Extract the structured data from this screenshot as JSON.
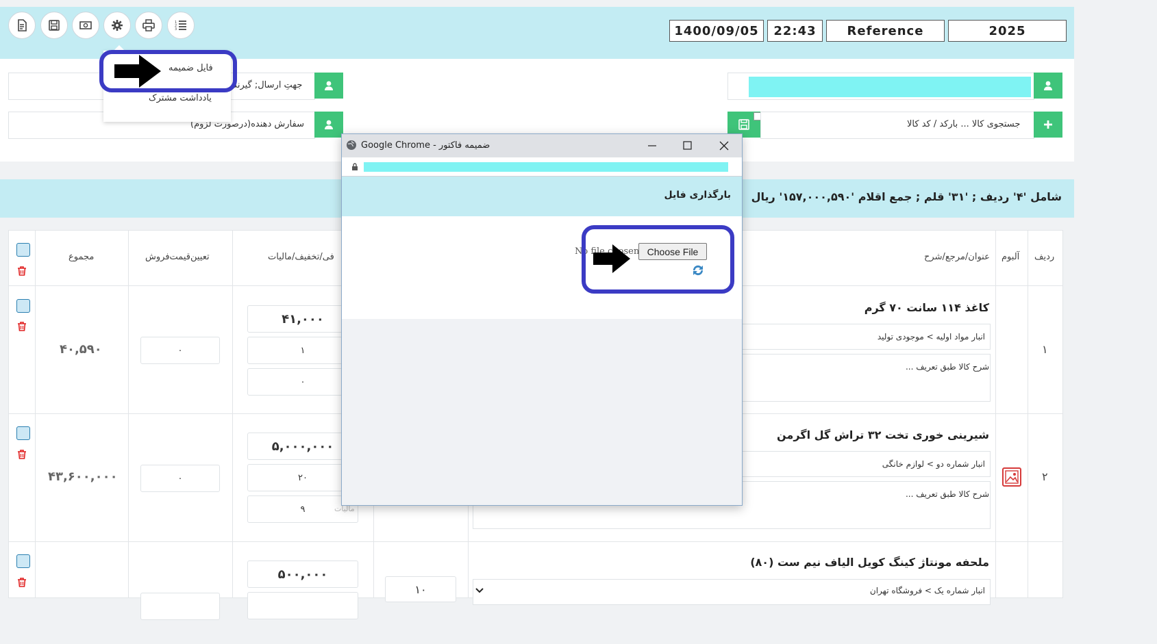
{
  "toolbar": {
    "buttons": [
      "document-icon",
      "save-icon",
      "money-icon",
      "gear-icon",
      "print-icon",
      "list-icon"
    ]
  },
  "header": {
    "date": "1400/09/05",
    "time": "22:43",
    "reference": "Reference",
    "number": "2025"
  },
  "dropdown_menu": {
    "items": [
      "فایل ضمیمه",
      "یادداشت مشترک"
    ]
  },
  "form": {
    "recipient_label": "جهتِ ارسال; گیرند",
    "orderer_label": "سفارش دهنده(درصورت لزوم)",
    "product_search_label": "جستجوی کالا ... بارکد / کد کالا"
  },
  "summary_text": "شامل '۴' ردیف ; '۳۱' قلم ; جمع اقلام '۱۵۷,۰۰۰,۵۹۰' ریال",
  "table": {
    "headers": {
      "row": "ردیف",
      "album": "آلبوم",
      "title": "عنوان/مرجع/شرح",
      "price": "فی/تخفیف/مالیات",
      "sale_price": "تعیین‌قیمت‌فروش",
      "total": "مجموع"
    },
    "rows": [
      {
        "num": "۱",
        "title": "کاغذ ۱۱۴ سانت ۷۰ گرم",
        "warehouse": "انبار مواد اولیه > موجودی تولید",
        "desc": "شرح کالا طبق تعریف ...",
        "price": "۴۱,۰۰۰",
        "discount": "۱",
        "tax": "۰",
        "sale": "۰",
        "total": "۴۰,۵۹۰"
      },
      {
        "num": "۲",
        "title": "شیرینی خوری تخت ۳۲ تراش گل اگرمن",
        "warehouse": "انبار شماره دو > لوازم خانگی",
        "desc": "شرح کالا طبق تعریف ...",
        "price": "۵,۰۰۰,۰۰۰",
        "discount": "۲۰",
        "tax": "۹",
        "tax_placeholder": "مالیات",
        "sale": "۰",
        "total": "۴۳,۶۰۰,۰۰۰"
      },
      {
        "num": "",
        "title": "ملحفه مونتاژ کینگ کویل الیاف نیم ست (۸۰)",
        "warehouse": "انبار شماره یک > فروشگاه تهران",
        "price": "۵۰۰,۰۰۰",
        "qty": "۱۰"
      }
    ]
  },
  "popup": {
    "window_title": "ضمیمه فاکتور - Google Chrome",
    "header_title": "بارگذاری فایل",
    "choose_file_label": "Choose File",
    "no_file_text": "No file chosen"
  },
  "colors": {
    "band": "#c3ecf3",
    "green": "#3fc47a",
    "highlight": "#3b3bc4",
    "cyan_redaction": "#7ff3f3"
  }
}
